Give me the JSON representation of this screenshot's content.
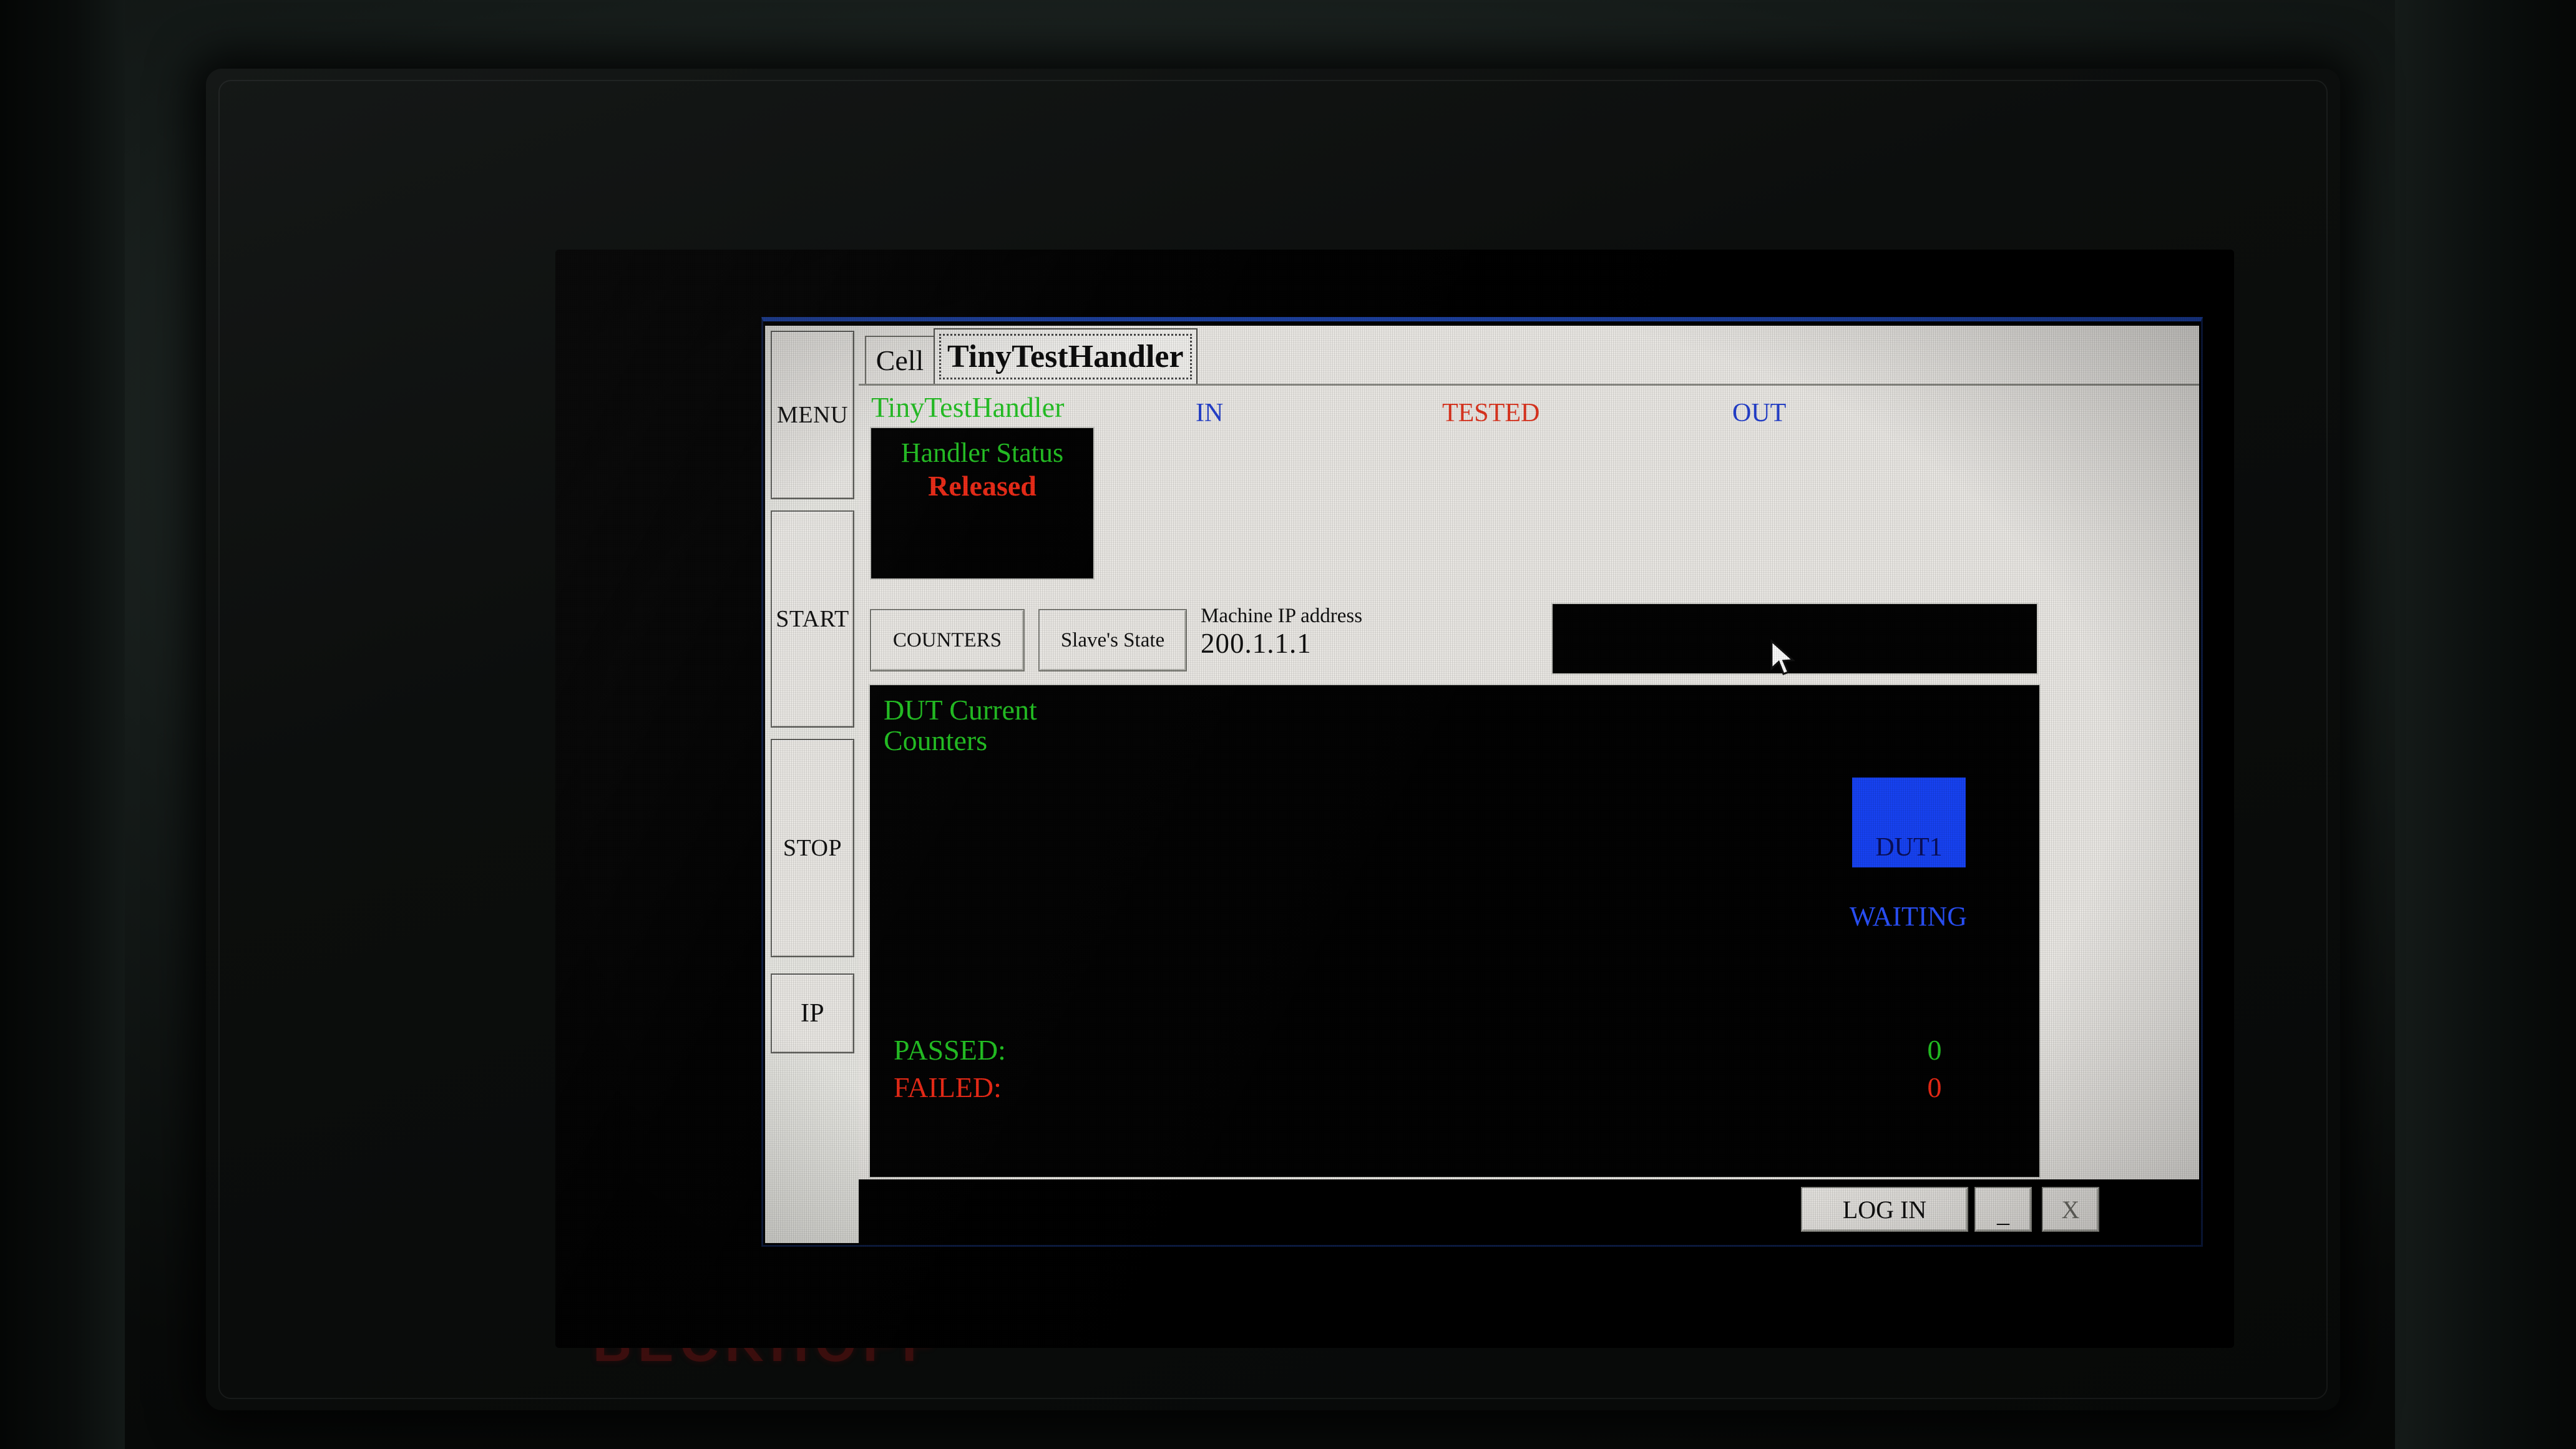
{
  "device": {
    "brand": "BECKHOFF"
  },
  "window": {
    "tabs": [
      {
        "label": "Cell",
        "selected": false
      },
      {
        "label": "TinyTestHandler",
        "selected": true
      }
    ],
    "bottom_bar": {
      "login_label": "LOG IN",
      "minimize_label": "_",
      "close_label": "X"
    }
  },
  "side_rail": {
    "items": [
      {
        "label": "MENU"
      },
      {
        "label": "START"
      },
      {
        "label": "STOP"
      },
      {
        "label": "IP"
      }
    ]
  },
  "page": {
    "subtitle": "TinyTestHandler",
    "columns": [
      {
        "label": "IN",
        "color": "#2440cf"
      },
      {
        "label": "TESTED",
        "color": "#e0341f"
      },
      {
        "label": "OUT",
        "color": "#2440cf"
      }
    ],
    "handler_status": {
      "title": "Handler Status",
      "value": "Released",
      "title_color": "#23c423",
      "value_color": "#ef2a16"
    },
    "buttons": {
      "counters": "COUNTERS",
      "slaves_state": "Slave's State"
    },
    "machine_ip": {
      "label": "Machine IP address",
      "value": "200.1.1.1"
    },
    "counters_panel": {
      "title": "DUT Current\nCounters",
      "title_color": "#23c423",
      "dut": {
        "box_label": "DUT1",
        "box_color": "#1743f5",
        "state": "WAITING",
        "state_color": "#2a52ff"
      },
      "rows": [
        {
          "label": "PASSED:",
          "value": "0",
          "color": "#23c423"
        },
        {
          "label": "FAILED:",
          "value": "0",
          "color": "#ef2a16"
        }
      ]
    }
  }
}
